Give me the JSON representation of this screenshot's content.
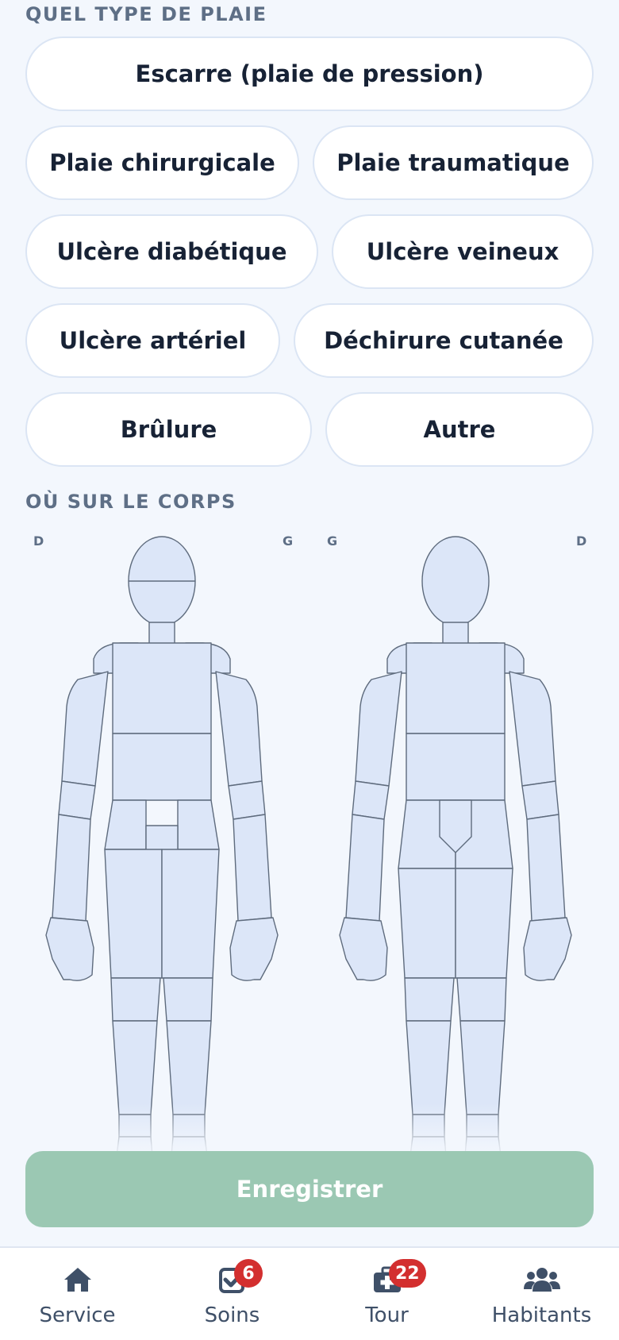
{
  "wound_type": {
    "title": "QUEL TYPE DE PLAIE",
    "options": [
      "Escarre (plaie de pression)",
      "Plaie chirurgicale",
      "Plaie traumatique",
      "Ulcère diabétique",
      "Ulcère veineux",
      "Ulcère artériel",
      "Déchirure cutanée",
      "Brûlure",
      "Autre"
    ]
  },
  "body_location": {
    "title": "OÙ SUR LE CORPS",
    "front": {
      "left_side": "D",
      "right_side": "G"
    },
    "back": {
      "left_side": "G",
      "right_side": "D"
    }
  },
  "save_label": "Enregistrer",
  "colors": {
    "background": "#f3f7fd",
    "save_button": "#9bc8b3",
    "body_fill": "#dce6f8",
    "badge": "#d32f2f"
  },
  "nav": [
    {
      "label": "Service",
      "icon": "home-icon"
    },
    {
      "label": "Soins",
      "icon": "check-square-icon",
      "badge": "6"
    },
    {
      "label": "Tour",
      "icon": "medkit-icon",
      "badge": "22"
    },
    {
      "label": "Habitants",
      "icon": "users-icon"
    }
  ]
}
